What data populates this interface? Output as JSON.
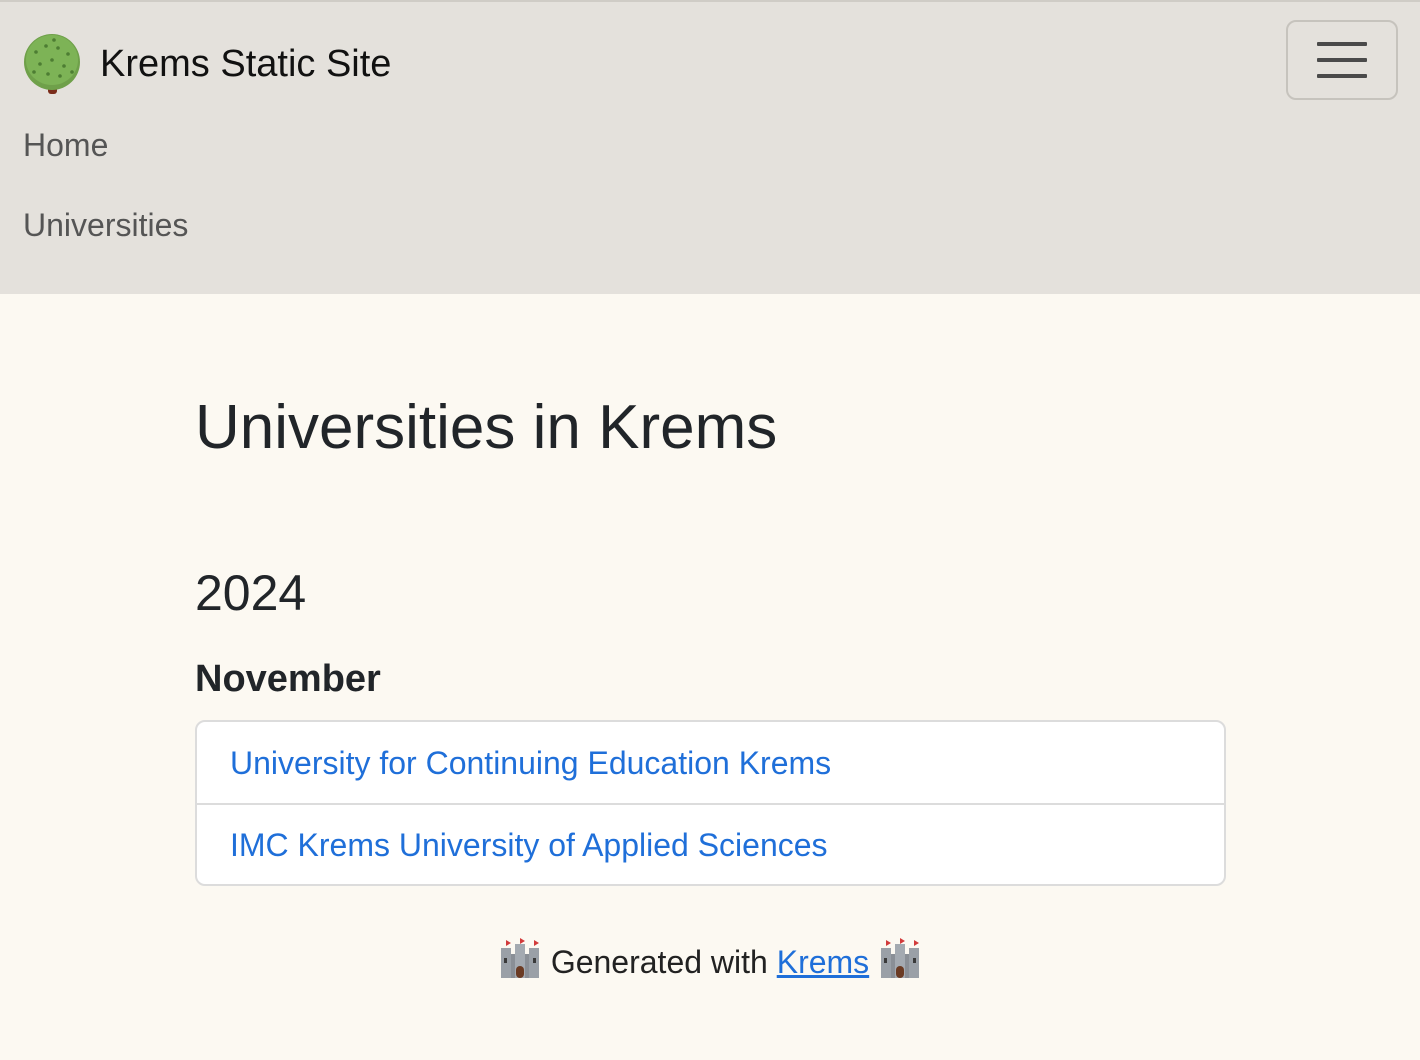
{
  "navbar": {
    "brand_text": "Krems Static Site",
    "brand_icon": "tree-icon",
    "toggler_icon": "hamburger-menu-icon",
    "links": [
      {
        "label": "Home"
      },
      {
        "label": "Universities"
      }
    ]
  },
  "main": {
    "title": "Universities in Krems",
    "year": "2024",
    "month": "November",
    "items": [
      {
        "label": "University for Continuing Education Krems"
      },
      {
        "label": "IMC Krems University of Applied Sciences"
      }
    ]
  },
  "footer": {
    "prefix": "Generated with ",
    "link_label": "Krems",
    "icon": "castle-icon"
  },
  "colors": {
    "navbar_bg": "#e4e1dc",
    "page_bg": "#fcf9f2",
    "link": "#1f6fd9"
  }
}
